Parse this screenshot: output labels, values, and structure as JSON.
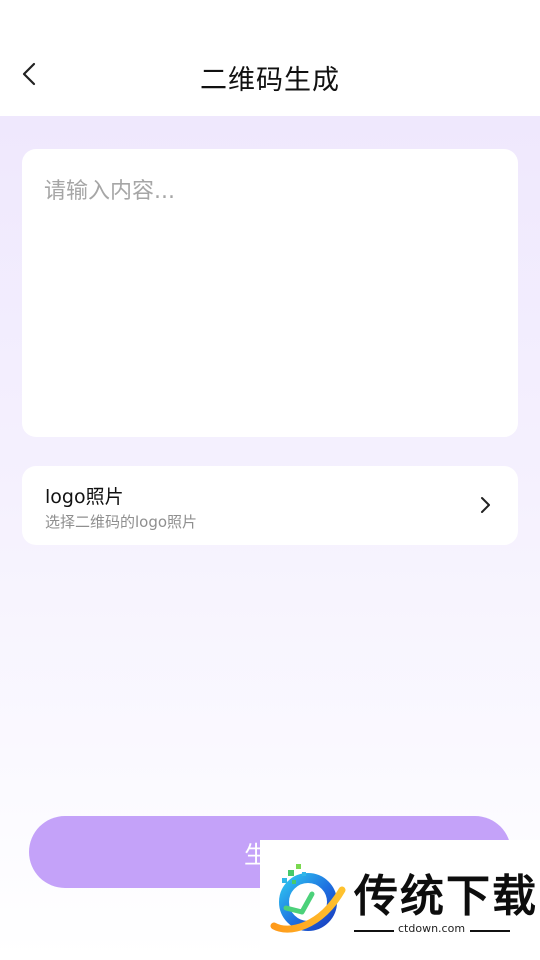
{
  "header": {
    "title": "二维码生成",
    "back_icon": "chevron-left-icon"
  },
  "content_input": {
    "placeholder": "请输入内容...",
    "value": ""
  },
  "logo_option": {
    "title": "logo照片",
    "subtitle": "选择二维码的logo照片",
    "icon": "chevron-right-icon"
  },
  "actions": {
    "generate_label": "生成"
  },
  "watermark": {
    "brand_text": "传统下载",
    "domain": "ctdown.com"
  },
  "colors": {
    "accent": "#c4a2f9",
    "background_top": "#efe8fd",
    "card": "#ffffff"
  }
}
